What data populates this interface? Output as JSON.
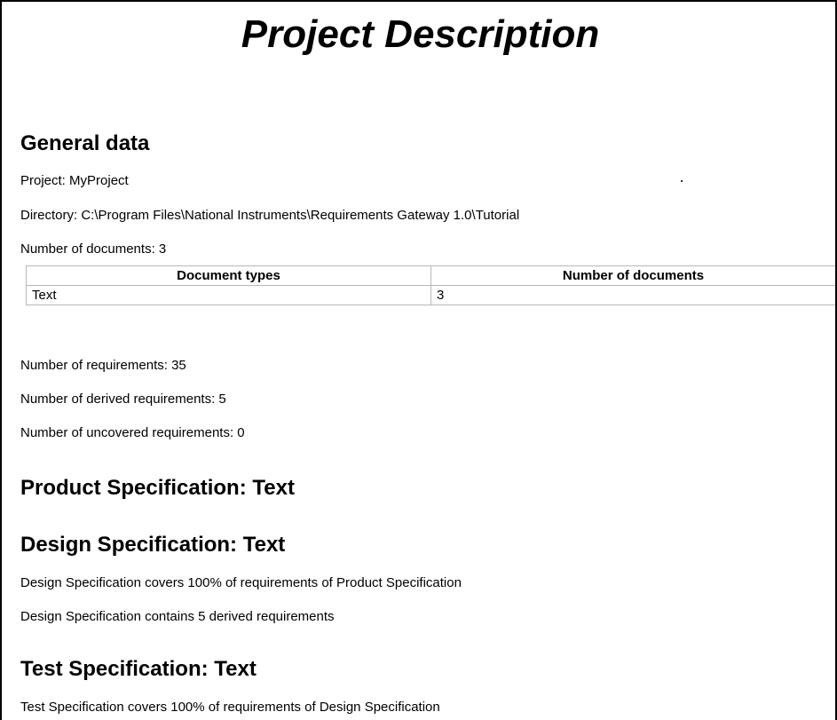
{
  "report": {
    "title": "Project Description",
    "general": {
      "heading": "General data",
      "project_line": "Project: MyProject",
      "directory_line": "Directory: C:\\Program Files\\National Instruments\\Requirements Gateway 1.0\\Tutorial",
      "documents_line": "Number of documents: 3",
      "table": {
        "headers": [
          "Document types",
          "Number of documents"
        ],
        "rows": [
          [
            "Text",
            "3"
          ]
        ]
      },
      "requirements_line": "Number of requirements: 35",
      "derived_line": "Number of derived requirements: 5",
      "uncovered_line": "Number of uncovered requirements: 0"
    },
    "product_spec": {
      "heading": "Product Specification: Text"
    },
    "design_spec": {
      "heading": "Design Specification: Text",
      "coverage_line": "Design Specification covers 100% of requirements of Product Specification",
      "derived_line": "Design Specification contains 5 derived requirements"
    },
    "test_spec": {
      "heading": "Test Specification: Text",
      "coverage_line": "Test Specification covers 100% of requirements of Design Specification"
    }
  }
}
